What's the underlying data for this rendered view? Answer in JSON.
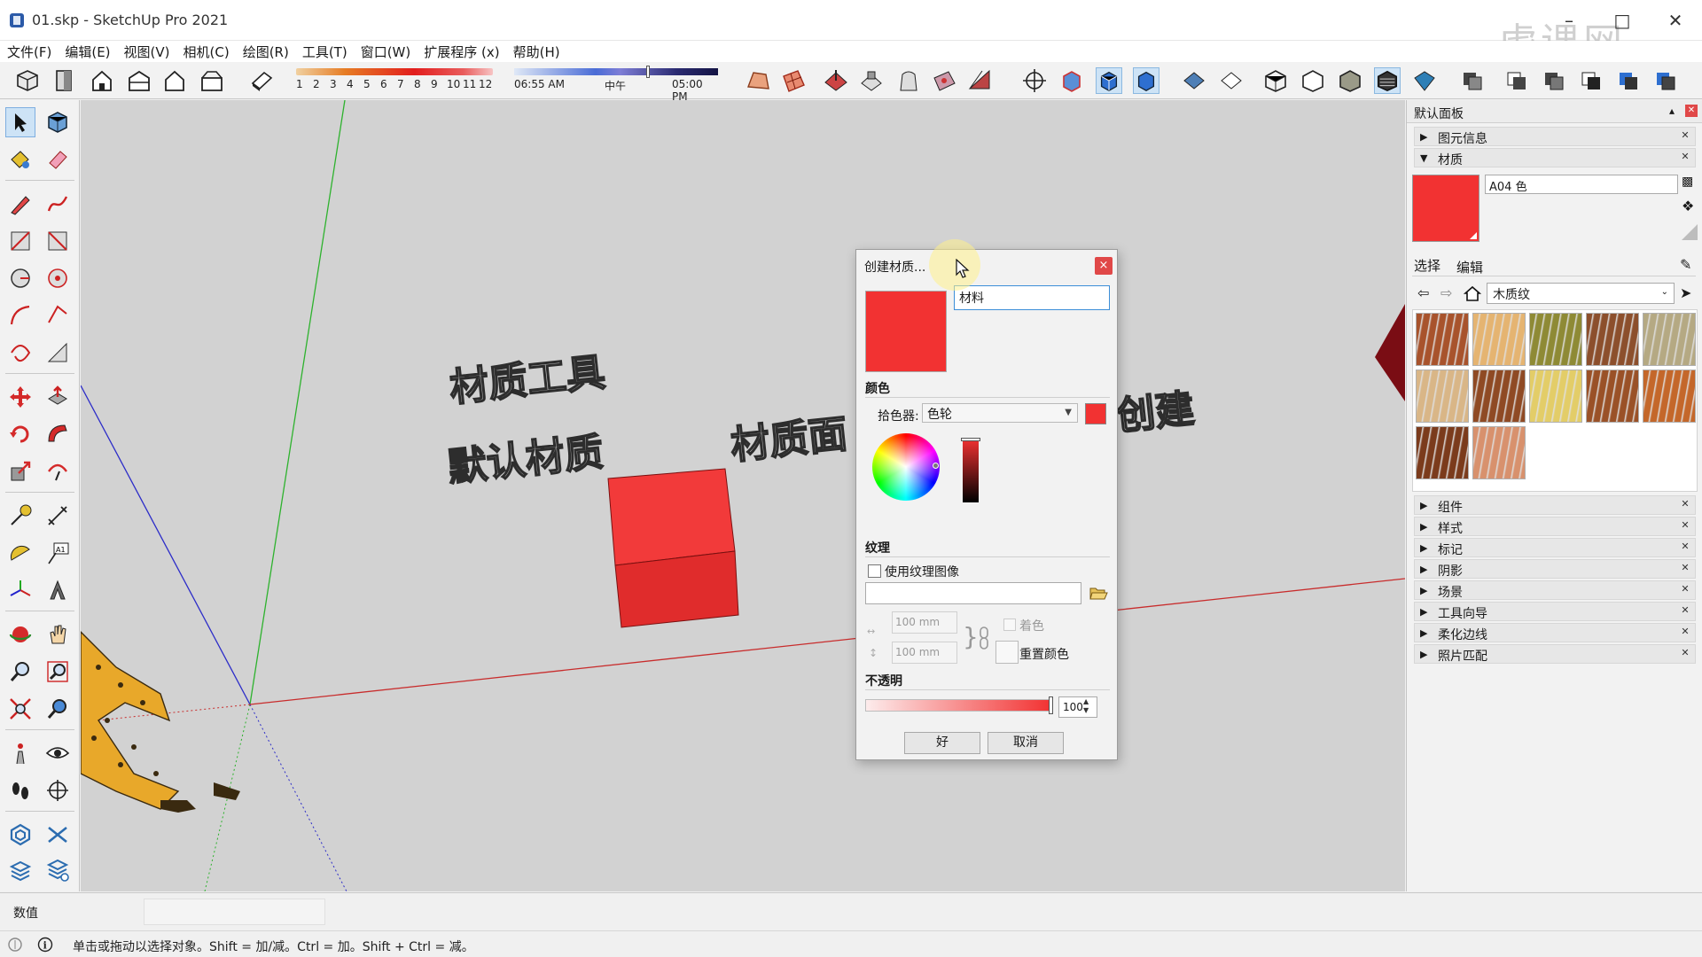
{
  "window": {
    "title": "01.skp - SketchUp Pro 2021",
    "watermark": "虎课网"
  },
  "menu": [
    "文件(F)",
    "编辑(E)",
    "视图(V)",
    "相机(C)",
    "绘图(R)",
    "工具(T)",
    "窗口(W)",
    "扩展程序 (x)",
    "帮助(H)"
  ],
  "toolbar": {
    "month_ticks": [
      "1",
      "2",
      "3",
      "4",
      "5",
      "6",
      "7",
      "8",
      "9",
      "10",
      "11",
      "12"
    ],
    "time_start": "06:55 AM",
    "time_mid": "中午",
    "time_end": "05:00 PM"
  },
  "scene": {
    "text_1": "材质工具",
    "text_2": "默认材质",
    "text_3": "材质面",
    "text_4": "创建"
  },
  "dialog": {
    "title": "创建材质...",
    "close": "×",
    "name_value": "材料",
    "color_section": "颜色",
    "picker_label": "拾色器:",
    "picker_value": "色轮",
    "texture_section": "纹理",
    "use_texture_label": "使用纹理图像",
    "width_value": "100 mm",
    "height_value": "100 mm",
    "colorize_label": "着色",
    "reset_color_label": "重置颜色",
    "opacity_section": "不透明",
    "opacity_value": "100",
    "ok_label": "好",
    "cancel_label": "取消",
    "preview_color": "#f23232"
  },
  "panel": {
    "title": "默认面板",
    "entity_info": "图元信息",
    "materials": "材质",
    "current_material": "A04 色",
    "tab_select": "选择",
    "tab_edit": "编辑",
    "library": "木质纹",
    "collapsed_sections": [
      "组件",
      "样式",
      "标记",
      "阴影",
      "场景",
      "工具向导",
      "柔化边线",
      "照片匹配"
    ],
    "swatch_colors": [
      "#a8532c",
      "#e5b471",
      "#8e8a35",
      "#8c4f2c",
      "#b5a983",
      "#d9b687",
      "#8f4a24",
      "#e3cd68",
      "#9a5127",
      "#c4672a",
      "#7b3b1c",
      "#d8916d"
    ]
  },
  "bottom": {
    "value_label": "数值",
    "status_text": "单击或拖动以选择对象。Shift = 加/减。Ctrl = 加。Shift + Ctrl = 减。"
  }
}
